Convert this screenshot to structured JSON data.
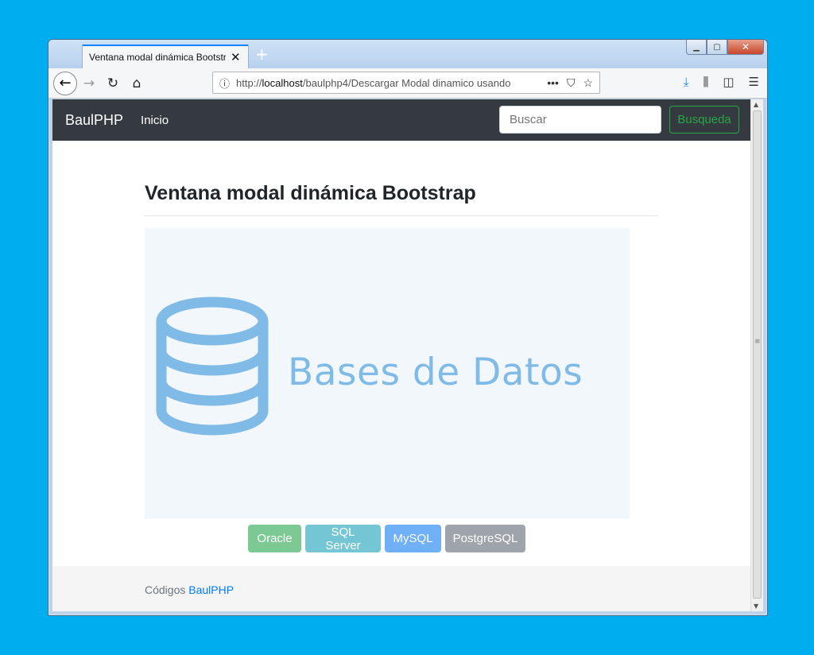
{
  "browser": {
    "tab_title": "Ventana modal dinámica Bootstrap",
    "tab_close": "✕",
    "new_tab": "+",
    "url_prefix": "http://",
    "url_host": "localhost",
    "url_path": "/baulphp4/Descargar Modal dinamico usando",
    "url_more": "•••",
    "win_min": "▁",
    "win_max": "▢",
    "win_close": "✕"
  },
  "site": {
    "brand": "BaulPHP",
    "nav_inicio": "Inicio",
    "search_placeholder": "Buscar",
    "search_button": "Busqueda"
  },
  "main": {
    "title": "Ventana modal dinámica Bootstrap",
    "hero_text": "Bases de Datos",
    "buttons": {
      "oracle": "Oracle",
      "sqlserver": "SQL Server",
      "mysql": "MySQL",
      "postgresql": "PostgreSQL"
    }
  },
  "footer": {
    "prefix": "Códigos ",
    "link": "BaulPHP"
  },
  "colors": {
    "desktop": "#00aeef",
    "navbar": "#343a40",
    "success": "#28a745",
    "hero_icon": "#7fbbe6"
  }
}
